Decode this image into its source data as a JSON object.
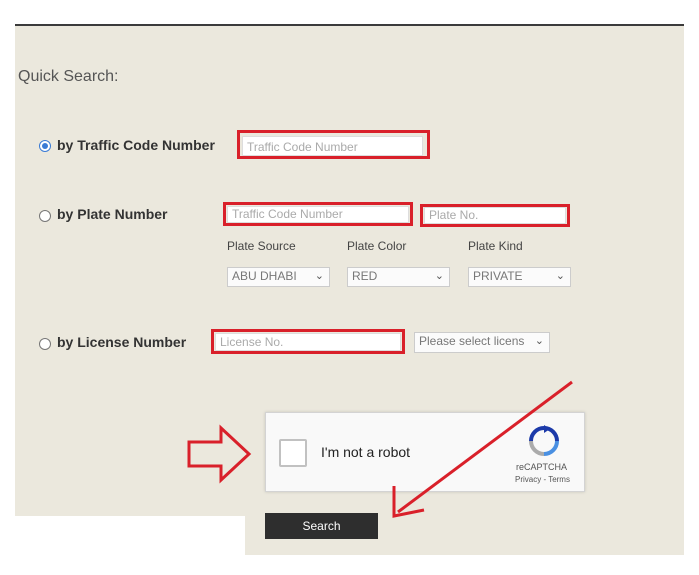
{
  "quick_search": {
    "title": "Quick Search:",
    "by_traffic_code": {
      "label": "by Traffic Code Number",
      "placeholder": "Traffic Code Number",
      "selected": true
    },
    "by_plate": {
      "label": "by Plate Number",
      "traffic_code_placeholder": "Traffic Code Number",
      "plate_no_placeholder": "Plate No.",
      "plate_source_label": "Plate Source",
      "plate_color_label": "Plate Color",
      "plate_kind_label": "Plate Kind",
      "plate_source_value": "ABU DHABI",
      "plate_color_value": "RED",
      "plate_kind_value": "PRIVATE"
    },
    "by_license": {
      "label": "by License Number",
      "license_placeholder": "License No.",
      "license_select_value": "Please select licens"
    }
  },
  "recaptcha": {
    "checkbox_label": "I'm not a robot",
    "brand": "reCAPTCHA",
    "links": "Privacy - Terms"
  },
  "search_button": {
    "label": "Search"
  },
  "colors": {
    "panel_bg": "#ebe8dd",
    "highlight_red": "#d9202a",
    "radio_blue": "#3a7bd5",
    "button_bg": "#2e2e2e"
  },
  "icons": [
    "chevron-down-icon",
    "recaptcha-logo-icon",
    "arrow-right-outline-icon",
    "arrow-diagonal-icon"
  ]
}
